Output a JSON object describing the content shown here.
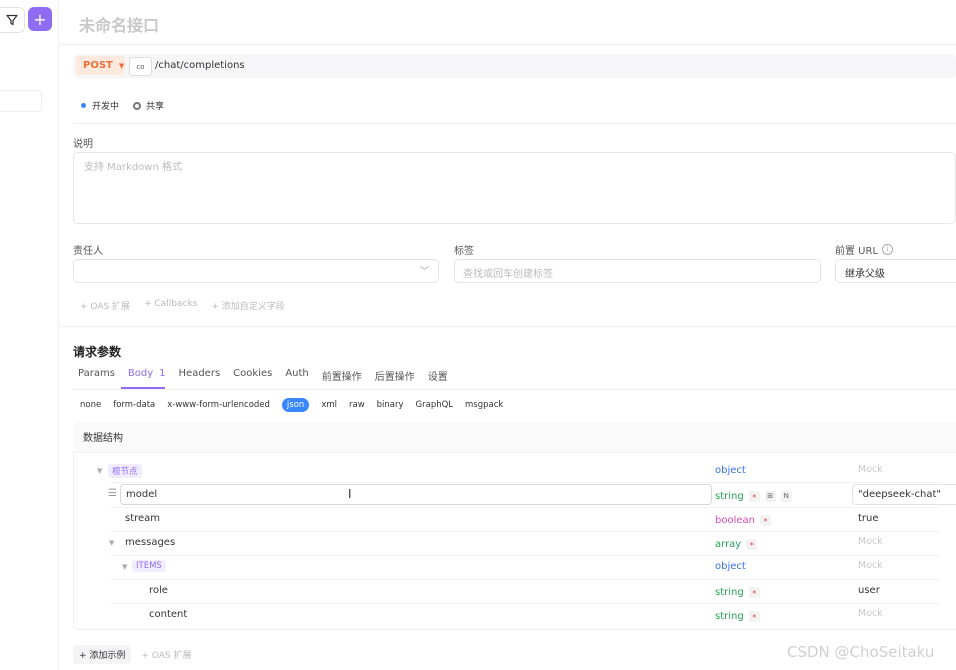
{
  "sidebar": {
    "filter_icon": "filter-icon",
    "add_icon": "plus-icon",
    "add_symbol": "+"
  },
  "header": {
    "title": "未命名接口"
  },
  "request": {
    "method": "POST",
    "env_chip": "co",
    "path": "/chat/completions"
  },
  "meta": {
    "status": "开发中",
    "share": "共享"
  },
  "description": {
    "label": "说明",
    "placeholder": "支持 Markdown 格式"
  },
  "owner": {
    "label": "责任人"
  },
  "tags": {
    "label": "标签",
    "placeholder": "查找或回车创建标签"
  },
  "prefix_url": {
    "label": "前置 URL",
    "value": "继承父级"
  },
  "extensions": [
    "+ OAS 扩展",
    "+ Callbacks",
    "+ 添加自定义字段"
  ],
  "params": {
    "title": "请求参数",
    "tabs": [
      "Params",
      "Body",
      "Headers",
      "Cookies",
      "Auth",
      "前置操作",
      "后置操作",
      "设置"
    ],
    "active_tab": "Body",
    "body_count": "1",
    "body_types": [
      "none",
      "form-data",
      "x-www-form-urlencoded",
      "json",
      "xml",
      "raw",
      "binary",
      "GraphQL",
      "msgpack"
    ],
    "active_body_type": "json"
  },
  "schema": {
    "title": "数据结构",
    "rows": [
      {
        "name": "根节点",
        "type": "object",
        "mock": "Mock"
      },
      {
        "name": "model",
        "type": "string",
        "mock": "\"deepseek-chat\""
      },
      {
        "name": "stream",
        "type": "boolean",
        "mock": "true"
      },
      {
        "name": "messages",
        "type": "array",
        "mock": "Mock"
      },
      {
        "name": "ITEMS",
        "type": "object",
        "mock": "Mock"
      },
      {
        "name": "role",
        "type": "string",
        "mock": "user"
      },
      {
        "name": "content",
        "type": "string",
        "mock": "Mock"
      }
    ],
    "required_mark": "*",
    "mini_icon_1": "⊞",
    "mini_icon_2": "N"
  },
  "footer": {
    "add_example": "+ 添加示例",
    "oas_ext": "+ OAS 扩展"
  },
  "watermark": "CSDN @ChoSeitaku",
  "colors": {
    "accent": "#8f6cf2",
    "post": "#e8703a",
    "object": "#3a6fdc",
    "string": "#2a9d5a",
    "boolean": "#d04fb0"
  }
}
